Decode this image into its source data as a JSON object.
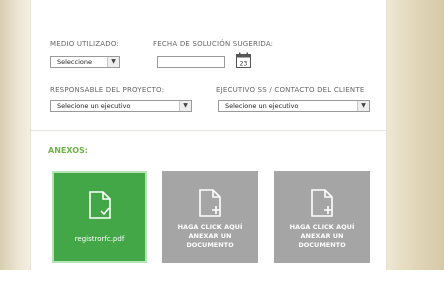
{
  "form": {
    "medio_label": "MEDIO UTILIZADO:",
    "medio_value": "Seleccione",
    "fecha_label": "FECHA DE SOLUCIÓN SUGERIDA:",
    "fecha_value": "",
    "calendar_day": "23",
    "responsable_label": "RESPONSABLE DEL PROYECTO:",
    "responsable_value": "Selecione un ejecutivo",
    "ejecutivo_label": "EJECUTIVO SS / CONTACTO DEL CLIENTE",
    "ejecutivo_value": "Selecione un ejecutivo"
  },
  "anexos": {
    "title": "ANEXOS:",
    "files": [
      {
        "name": "registrorfc.pdf"
      }
    ],
    "upload_tiles": [
      {
        "line1": "HAGA CLICK AQUÍ",
        "line2": "ANEXAR UN",
        "line3": "DOCUMENTO"
      },
      {
        "line1": "HAGA CLICK AQUÍ",
        "line2": "ANEXAR UN",
        "line3": "DOCUMENTO"
      }
    ]
  },
  "colors": {
    "accent_green": "#43a647",
    "section_title": "#6fb349",
    "tile_gray": "#a5a5a5"
  }
}
